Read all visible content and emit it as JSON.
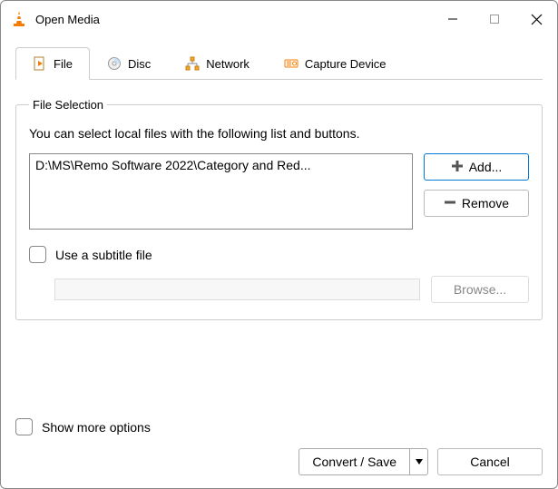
{
  "window": {
    "title": "Open Media"
  },
  "tabs": {
    "file": "File",
    "disc": "Disc",
    "network": "Network",
    "capture": "Capture Device"
  },
  "file_selection": {
    "legend": "File Selection",
    "hint": "You can select local files with the following list and buttons.",
    "selected_path": "D:\\MS\\Remo Software 2022\\Category and Red...",
    "add_label": "Add...",
    "remove_label": "Remove"
  },
  "subtitle": {
    "checkbox_label": "Use a subtitle file",
    "browse_label": "Browse..."
  },
  "footer": {
    "show_more_label": "Show more options",
    "convert_label": "Convert / Save",
    "cancel_label": "Cancel"
  }
}
